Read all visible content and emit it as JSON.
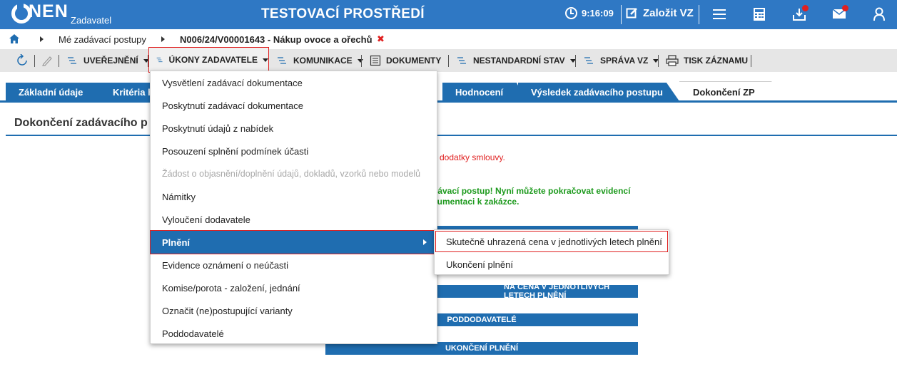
{
  "topbar": {
    "logo_text": "NEN",
    "logo_sub": "Zadavatel",
    "env_title": "TESTOVACÍ PROSTŘEDÍ",
    "time": "9:16:09",
    "create_label": "Založit VZ"
  },
  "breadcrumb": {
    "home_icon": "home-icon",
    "item1": "Mé zadávací postupy",
    "item2": "N006/24/V00001643 - Nákup ovoce a ořechů",
    "close_symbol": "✖"
  },
  "toolbar": {
    "refresh_icon": "refresh-icon",
    "edit_icon": "pencil-icon",
    "items": [
      {
        "label": "UVEŘEJNĚNÍ"
      },
      {
        "label": "ÚKONY ZADAVATELE"
      },
      {
        "label": "KOMUNIKACE"
      },
      {
        "label": "DOKUMENTY"
      },
      {
        "label": "NESTANDARDNÍ STAV"
      },
      {
        "label": "SPRÁVA VZ"
      },
      {
        "label": "TISK ZÁZNAMU"
      }
    ]
  },
  "tabs": [
    {
      "label": "Základní údaje"
    },
    {
      "label": "Kritéria h"
    },
    {
      "label": "Hodnocení"
    },
    {
      "label": "Výsledek zadávacího postupu"
    },
    {
      "label": "Dokončení ZP"
    }
  ],
  "main": {
    "section_title": "Dokončení zadávacího p",
    "msg_red": "dodatky smlouvy.",
    "msg_green_1": "dávací postup! Nyní můžete pokračovat evidencí",
    "msg_green_2": "kumentaci k zakázce.",
    "bars": [
      "NÁ CENA V JEDNOTLIVÝCH LETECH PLNĚNÍ",
      "PODDODAVATELÉ",
      "UKONČENÍ PLNĚNÍ"
    ]
  },
  "dropdown": {
    "items": [
      {
        "label": "Vysvětlení zadávací dokumentace"
      },
      {
        "label": "Poskytnutí zadávací dokumentace"
      },
      {
        "label": "Poskytnutí údajů z nabídek"
      },
      {
        "label": "Posouzení splnění podmínek účasti"
      },
      {
        "label": "Žádost o objasnění/doplnění údajů, dokladů, vzorků nebo modelů"
      },
      {
        "label": "Námitky"
      },
      {
        "label": "Vyloučení dodavatele"
      },
      {
        "label": "Plnění"
      },
      {
        "label": "Evidence oznámení o neúčasti"
      },
      {
        "label": "Komise/porota - založení, jednání"
      },
      {
        "label": "Označit (ne)postupující varianty"
      },
      {
        "label": "Poddodavatelé"
      }
    ]
  },
  "submenu": {
    "items": [
      {
        "label": "Skutečně uhrazená cena v jednotlivých letech plnění"
      },
      {
        "label": "Ukončení plnění"
      }
    ]
  }
}
